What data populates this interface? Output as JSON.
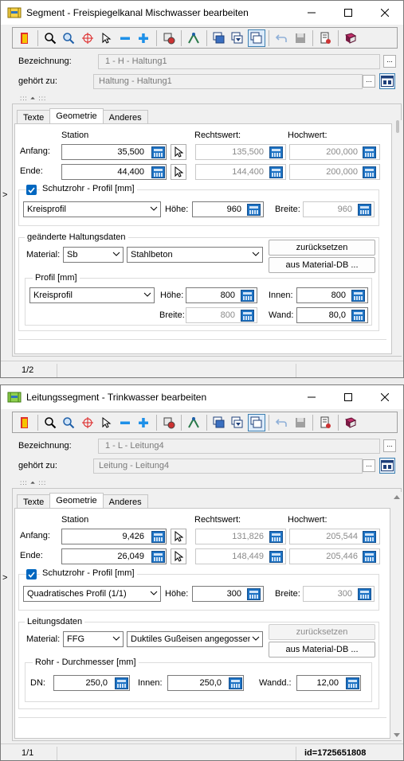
{
  "colors": {
    "accent": "#0067c0",
    "calc_blue": "#1e73c4"
  },
  "window1": {
    "title": "Segment - Freispiegelkanal Mischwasser bearbeiten",
    "bezeichnung_label": "Bezeichnung:",
    "bezeichnung_value": "1 - H - Haltung1",
    "gehoert_label": "gehört zu:",
    "gehoert_value": "Haltung - Haltung1",
    "tabs": [
      "Texte",
      "Geometrie",
      "Anderes"
    ],
    "active_tab": "Geometrie",
    "col_station": "Station",
    "col_rechtswert": "Rechtswert:",
    "col_hochwert": "Hochwert:",
    "row_anfang": "Anfang:",
    "row_ende": "Ende:",
    "anfang": {
      "station": "35,500",
      "rechtswert": "135,500",
      "hochwert": "200,000"
    },
    "ende": {
      "station": "44,400",
      "rechtswert": "144,400",
      "hochwert": "200,000"
    },
    "schutzrohr": {
      "title": "Schutzrohr - Profil [mm]",
      "checked": true,
      "profile": "Kreisprofil",
      "hoehe_label": "Höhe:",
      "hoehe": "960",
      "breite_label": "Breite:",
      "breite": "960"
    },
    "haltung": {
      "title": "geänderte Haltungsdaten",
      "material_label": "Material:",
      "material_code": "Sb",
      "material_name": "Stahlbeton",
      "reset_label": "zurücksetzen",
      "db_label": "aus Material-DB ..."
    },
    "profil": {
      "title": "Profil [mm]",
      "type": "Kreisprofil",
      "hoehe_label": "Höhe:",
      "hoehe": "800",
      "innen_label": "Innen:",
      "innen": "800",
      "breite_label": "Breite:",
      "breite": "800",
      "wand_label": "Wand:",
      "wand": "80,0"
    },
    "status_page": "1/2"
  },
  "window2": {
    "title": "Leitungssegment - Trinkwasser bearbeiten",
    "bezeichnung_label": "Bezeichnung:",
    "bezeichnung_value": "1 - L - Leitung4",
    "gehoert_label": "gehört zu:",
    "gehoert_value": "Leitung - Leitung4",
    "tabs": [
      "Texte",
      "Geometrie",
      "Anderes"
    ],
    "active_tab": "Geometrie",
    "col_station": "Station",
    "col_rechtswert": "Rechtswert:",
    "col_hochwert": "Hochwert:",
    "row_anfang": "Anfang:",
    "row_ende": "Ende:",
    "anfang": {
      "station": "9,426",
      "rechtswert": "131,826",
      "hochwert": "205,544"
    },
    "ende": {
      "station": "26,049",
      "rechtswert": "148,449",
      "hochwert": "205,446"
    },
    "schutzrohr": {
      "title": "Schutzrohr - Profil [mm]",
      "checked": true,
      "profile": "Quadratisches Profil (1/1)",
      "hoehe_label": "Höhe:",
      "hoehe": "300",
      "breite_label": "Breite:",
      "breite": "300"
    },
    "leitung": {
      "title": "Leitungsdaten",
      "material_label": "Material:",
      "material_code": "FFG",
      "material_name": "Duktiles Gußeisen angegossene",
      "reset_label": "zurücksetzen",
      "db_label": "aus Material-DB ..."
    },
    "rohr": {
      "title": "Rohr - Durchmesser [mm]",
      "dn_label": "DN:",
      "dn": "250,0",
      "innen_label": "Innen:",
      "innen": "250,0",
      "wandd_label": "Wandd.:",
      "wandd": "12,00"
    },
    "status_page": "1/1",
    "status_id": "id=1725651808"
  }
}
